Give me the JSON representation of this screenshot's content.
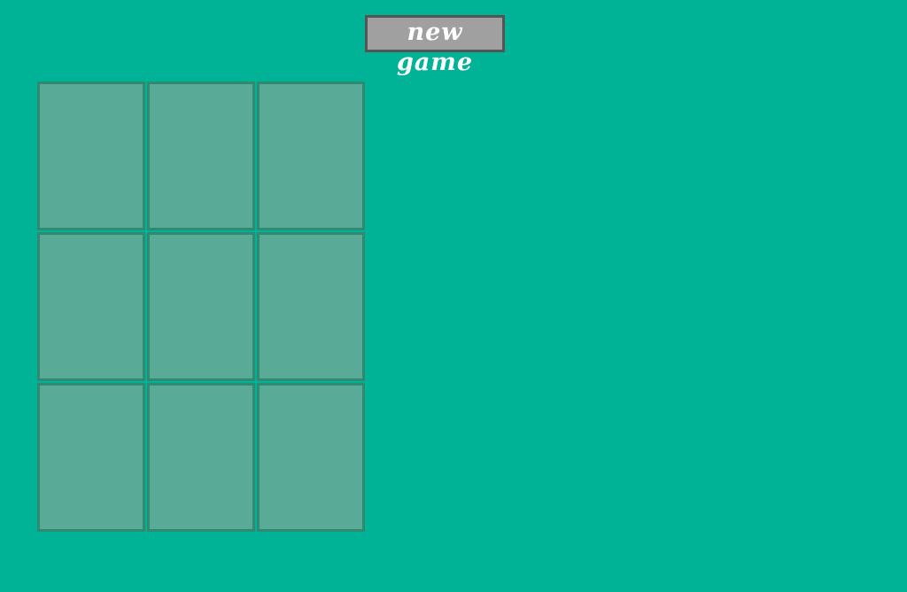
{
  "toolbar": {
    "new_game_label": "new game"
  },
  "board": {
    "rows": 3,
    "cols": 3,
    "cards": [
      {
        "face": "down"
      },
      {
        "face": "down"
      },
      {
        "face": "down"
      },
      {
        "face": "down"
      },
      {
        "face": "down"
      },
      {
        "face": "down"
      },
      {
        "face": "down"
      },
      {
        "face": "down"
      },
      {
        "face": "down"
      }
    ]
  },
  "colors": {
    "background": "#00b397",
    "card": "#5aaa98",
    "card_border": "#2f8a72",
    "button": "#a0a0a0"
  }
}
